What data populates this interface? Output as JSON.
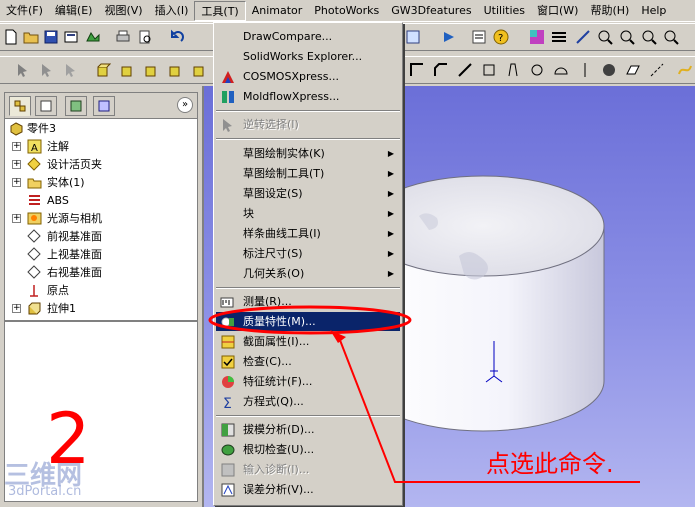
{
  "menubar": {
    "items": [
      "文件(F)",
      "编辑(E)",
      "视图(V)",
      "插入(I)",
      "工具(T)",
      "Animator",
      "PhotoWorks",
      "GW3Dfeatures",
      "Utilities",
      "窗口(W)",
      "帮助(H)",
      "Help"
    ]
  },
  "tools_menu": {
    "items": [
      {
        "label": "DrawCompare...",
        "icon": "none"
      },
      {
        "label": "SolidWorks Explorer...",
        "icon": "none"
      },
      {
        "label": "COSMOSXpress...",
        "icon": "cosmos-icon"
      },
      {
        "label": "MoldflowXpress...",
        "icon": "moldflow-icon"
      },
      {
        "label": "逆转选择(I)",
        "icon": "cursor-icon"
      },
      {
        "label": "草图绘制实体(K)",
        "icon": "none"
      },
      {
        "label": "草图绘制工具(T)",
        "icon": "none"
      },
      {
        "label": "草图设定(S)",
        "icon": "none"
      },
      {
        "label": "块",
        "icon": "none"
      },
      {
        "label": "样条曲线工具(I)",
        "icon": "none"
      },
      {
        "label": "标注尺寸(S)",
        "icon": "none"
      },
      {
        "label": "几何关系(O)",
        "icon": "none"
      },
      {
        "label": "测量(R)...",
        "icon": "measure-icon"
      },
      {
        "label": "质量特性(M)...",
        "icon": "mass-properties-icon"
      },
      {
        "label": "截面属性(I)...",
        "icon": "section-properties-icon"
      },
      {
        "label": "检查(C)...",
        "icon": "check-icon"
      },
      {
        "label": "特征统计(F)...",
        "icon": "feature-statistics-icon"
      },
      {
        "label": "方程式(Q)...",
        "icon": "equation-icon"
      },
      {
        "label": "拔模分析(D)...",
        "icon": "draft-analysis-icon"
      },
      {
        "label": "根切检查(U)...",
        "icon": "undercut-icon"
      },
      {
        "label": "输入诊断(I)...",
        "icon": "import-diagnostics-icon"
      },
      {
        "label": "误差分析(V)...",
        "icon": "deviation-analysis-icon"
      }
    ]
  },
  "tree": {
    "root": "零件3",
    "items": [
      "注解",
      "设计活页夹",
      "实体(1)",
      "ABS",
      "光源与相机",
      "前视基准面",
      "上视基准面",
      "右视基准面",
      "原点",
      "拉伸1"
    ]
  },
  "annotation": {
    "callout": "点选此命令.",
    "digit": "2"
  },
  "watermark": {
    "logo": "三维网",
    "site": "3dPortal.cn"
  },
  "colors": {
    "highlight": "#0a246a",
    "annotation": "#ff0000",
    "viewport": "#8d91e6"
  }
}
